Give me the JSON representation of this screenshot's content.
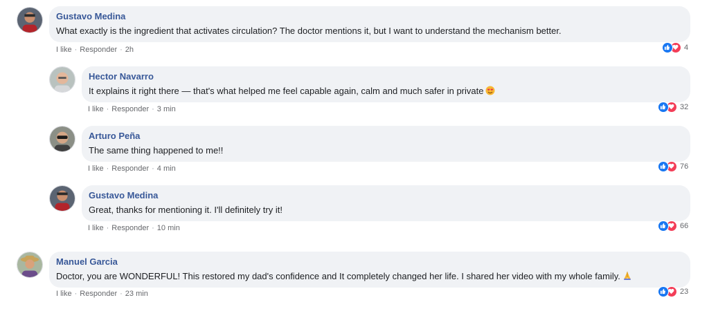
{
  "comments": [
    {
      "author": "Gustavo Medina",
      "text": "What exactly is the ingredient that activates circulation? The doctor mentions it, but I want to understand the mechanism better.",
      "like_label": "I like",
      "reply_label": "Responder",
      "time": "2h",
      "reaction_count": "4"
    },
    {
      "author": "Hector Navarro",
      "text": "It explains it right there — that's what helped me feel capable again, calm and much safer in private",
      "emoji": "smiling-face-with-heart-eyes",
      "like_label": "I like",
      "reply_label": "Responder",
      "time": "3 min",
      "reaction_count": "32"
    },
    {
      "author": "Arturo Peña",
      "text": "The same thing happened to me!!",
      "like_label": "I like",
      "reply_label": "Responder",
      "time": "4 min",
      "reaction_count": "76"
    },
    {
      "author": "Gustavo Medina",
      "text": "Great, thanks for mentioning it. I'll definitely try it!",
      "like_label": "I like",
      "reply_label": "Responder",
      "time": "10 min",
      "reaction_count": "66"
    },
    {
      "author": "Manuel Garcia",
      "text": "Doctor, you are WONDERFUL! This restored my dad's confidence and It completely changed her life. I shared her video with my whole family.",
      "emoji": "folded-hands",
      "like_label": "I like",
      "reply_label": "Responder",
      "time": "23 min",
      "reaction_count": "23"
    }
  ],
  "colors": {
    "author": "#385898",
    "bubble": "#f0f2f5",
    "like": "#1877f2",
    "love": "#f33e58",
    "meta": "#65676b"
  }
}
